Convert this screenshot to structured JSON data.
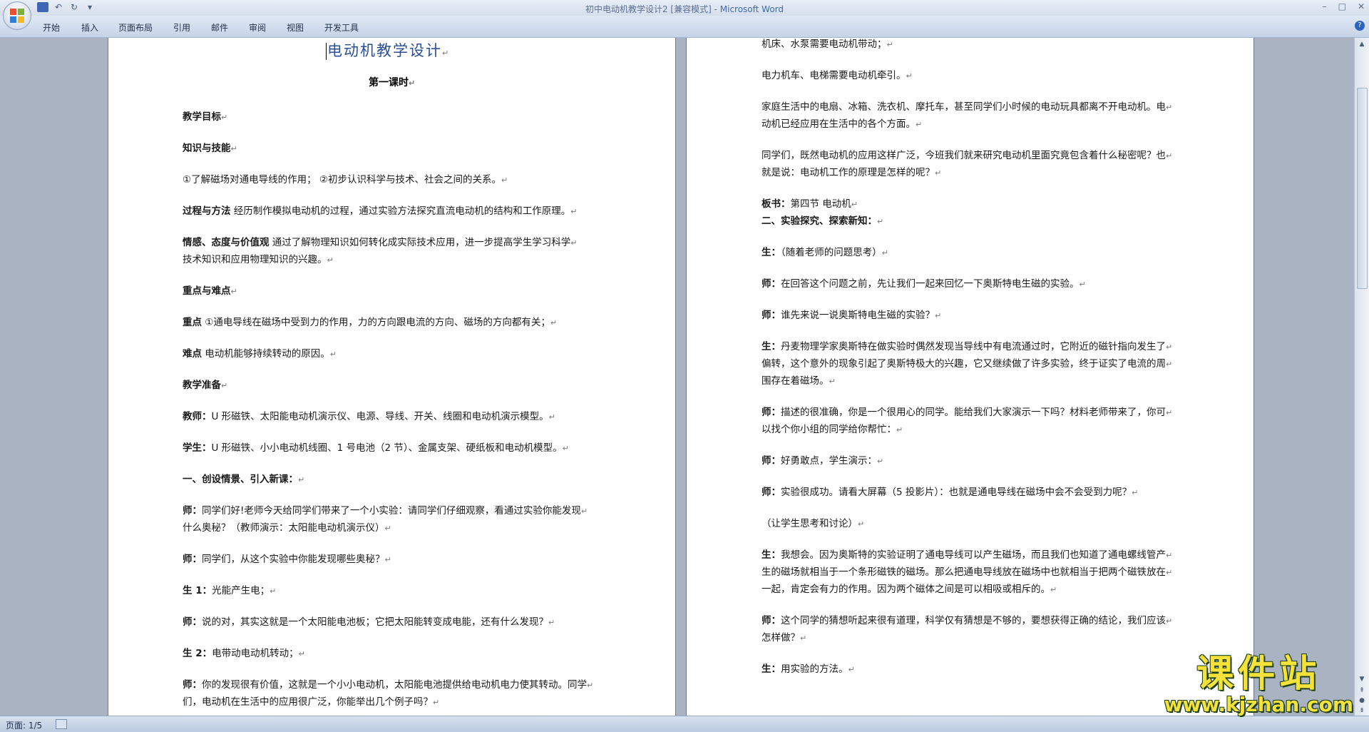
{
  "window": {
    "doc_name": "初中电动机教学设计2 [兼容模式]",
    "separator": " - ",
    "app_name": "Microsoft Word",
    "controls": [
      "–",
      "□",
      "✕"
    ]
  },
  "ribbon": {
    "tabs": [
      "开始",
      "插入",
      "页面布局",
      "引用",
      "邮件",
      "审阅",
      "视图",
      "开发工具"
    ]
  },
  "page1": {
    "title": "电动机教学设计",
    "subtitle": "第一课时",
    "para_mark": "↵",
    "lines": [
      {
        "b": "教学目标",
        "t": ""
      },
      {
        "b": "知识与技能",
        "t": ""
      },
      {
        "b": "",
        "t": "①了解磁场对通电导线的作用；        ②初步认识科学与技术、社会之间的关系。"
      },
      {
        "b": "过程与方法",
        "t": "      经历制作模拟电动机的过程，通过实验方法探究直流电动机的结构和工作原理。"
      },
      {
        "b": "情感、态度与价值观",
        "t": "      通过了解物理知识如何转化成实际技术应用，进一步提高学生学习科学"
      },
      {
        "b": "",
        "t": "技术知识和应用物理知识的兴趣。"
      },
      {
        "b": "重点与难点",
        "t": ""
      },
      {
        "b": "重点",
        "t": "      ①通电导线在磁场中受到力的作用，力的方向跟电流的方向、磁场的方向都有关；"
      },
      {
        "b": "难点",
        "t": "  电动机能够持续转动的原因。"
      },
      {
        "b": "教学准备",
        "t": ""
      },
      {
        "b": "教师：",
        "t": "U 形磁铁、太阳能电动机演示仪、电源、导线、开关、线圈和电动机演示模型。"
      },
      {
        "b": "学生：",
        "t": "U 形磁铁、小小电动机线圈、1 号电池（2 节）、金属支架、硬纸板和电动机模型。"
      },
      {
        "b": "一、创设情景、引入新课：",
        "t": ""
      },
      {
        "b": "师：",
        "t": "同学们好!老师今天给同学们带来了一个小实验：请同学们仔细观察，看通过实验你能发现"
      },
      {
        "b": "",
        "t": "什么奥秘？（教师演示：太阳能电动机演示仪）"
      },
      {
        "b": "师：",
        "t": "同学们，从这个实验中你能发现哪些奥秘？"
      },
      {
        "b": "生 1：",
        "t": "光能产生电；"
      },
      {
        "b": "师：",
        "t": "说的对，其实这就是一个太阳能电池板；它把太阳能转变成电能，还有什么发现？"
      },
      {
        "b": "生 2：",
        "t": "电带动电动机转动；"
      },
      {
        "b": "师：",
        "t": "你的发现很有价值，这就是一个小小电动机，太阳能电池提供给电动机电力使其转动。同学"
      },
      {
        "b": "",
        "t": "们，电动机在生活中的应用很广泛，你能举出几个例子吗？"
      }
    ]
  },
  "page2": {
    "lines": [
      {
        "b": "",
        "t": "机床、水泵需要电动机带动；"
      },
      {
        "b": "",
        "t": "电力机车、电梯需要电动机牵引。"
      },
      {
        "b": "",
        "t": "家庭生活中的电扇、冰箱、洗衣机、摩托车，甚至同学们小时候的电动玩具都离不开电动机。电"
      },
      {
        "b": "",
        "t": "动机已经应用在生活中的各个方面。"
      },
      {
        "b": "",
        "t": "同学们，既然电动机的应用这样广泛，今班我们就来研究电动机里面究竟包含着什么秘密呢？也"
      },
      {
        "b": "",
        "t": "就是说：电动机工作的原理是怎样的呢？"
      },
      {
        "b": "板书：",
        "t": "第四节  电动机"
      },
      {
        "b": "二、实验探究、探索新知：",
        "t": ""
      },
      {
        "b": "生：",
        "t": "（随着老师的问题思考）"
      },
      {
        "b": "师：",
        "t": "在回答这个问题之前，先让我们一起来回忆一下奥斯特电生磁的实验。"
      },
      {
        "b": "师：",
        "t": "谁先来说一说奥斯特电生磁的实验？"
      },
      {
        "b": "生：",
        "t": "丹麦物理学家奥斯特在做实验时偶然发现当导线中有电流通过时，它附近的磁针指向发生了"
      },
      {
        "b": "",
        "t": "偏转，这个意外的现象引起了奥斯特极大的兴趣，它又继续做了许多实验，终于证实了电流的周"
      },
      {
        "b": "",
        "t": "围存在着磁场。"
      },
      {
        "b": "师：",
        "t": "描述的很准确，你是一个很用心的同学。能给我们大家演示一下吗？材料老师带来了，你可"
      },
      {
        "b": "",
        "t": "以找个你小组的同学给你帮忙："
      },
      {
        "b": "师：",
        "t": "好勇敢点，学生演示："
      },
      {
        "b": "师：",
        "t": "实验很成功。请看大屏幕（5 投影片）：也就是通电导线在磁场中会不会受到力呢？"
      },
      {
        "b": "",
        "t": "（让学生思考和讨论）"
      },
      {
        "b": "生：",
        "t": "我想会。因为奥斯特的实验证明了通电导线可以产生磁场，而且我们也知道了通电螺线管产"
      },
      {
        "b": "",
        "t": "生的磁场就相当于一个条形磁铁的磁场。那么把通电导线放在磁场中也就相当于把两个磁铁放在"
      },
      {
        "b": "",
        "t": "一起，肯定会有力的作用。因为两个磁体之间是可以相吸或相斥的。"
      },
      {
        "b": "师：",
        "t": "这个同学的猜想听起来很有道理，科学仅有猜想是不够的，要想获得正确的结论，我们应该"
      },
      {
        "b": "",
        "t": "怎样做？"
      },
      {
        "b": "生：",
        "t": "用实验的方法。"
      }
    ]
  },
  "statusbar": {
    "page_info": "页面: 1/5"
  },
  "watermark": {
    "text": "课件站",
    "url": "www.kjzhan.com"
  },
  "colors": {
    "title_blue": "#2b4f95",
    "watermark_yellow": "#f4e23a"
  }
}
